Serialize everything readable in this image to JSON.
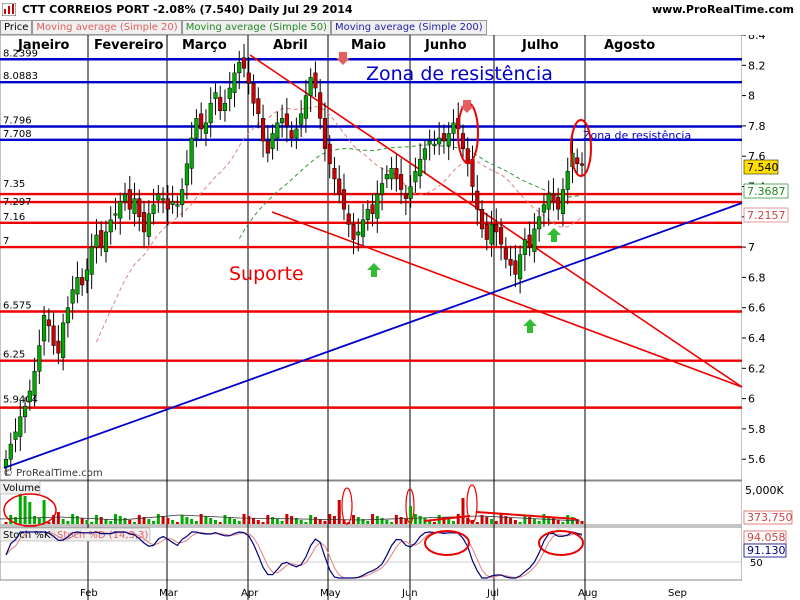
{
  "header": {
    "title": "CTT CORREIOS PORT   -2.08% (7.540)   Daily   Jul 29 2014",
    "site": "www.ProRealTime.com",
    "legend": {
      "price": "Price",
      "ma20": "Moving average (Simple 20)",
      "ma50": "Moving average (Simple 50)",
      "ma200": "Moving average (Simple 200)"
    },
    "copyright": "© ProRealTime.com"
  },
  "colors": {
    "up": "#00aa00",
    "down": "#cc0000",
    "resistance": "#0000cc",
    "support": "#ee0000",
    "ma20": "#e08080",
    "ma50": "#339933",
    "stoch_k": "#000080",
    "stoch_d": "#e08080"
  },
  "annotations": {
    "zona_main": "Zona de resistência",
    "zona_small": "Zona de resistência",
    "suporte": "Suporte"
  },
  "months": [
    "Janeiro",
    "Fevereiro",
    "Março",
    "Abril",
    "Maio",
    "Junho",
    "Julho",
    "Agosto"
  ],
  "price_tags": {
    "last": "7.540",
    "ma50": "7.3687",
    "ma20": "7.2157"
  },
  "volume_panel": {
    "label": "Volume",
    "max": "5,000K",
    "last": "373,750"
  },
  "stoch_panel": {
    "label_k": "Stoch %K",
    "label_d": "Stoch %D (14,3,3)",
    "d_value": "94.058",
    "k_value": "91.130",
    "level": "50"
  },
  "chart_data": {
    "type": "candlestick",
    "y_axis_ticks": [
      "8.4",
      "8.2",
      "8",
      "7.8",
      "7.6",
      "7.4",
      "7.2",
      "7",
      "6.8",
      "6.6",
      "6.4",
      "6.2",
      "6",
      "5.8",
      "5.6"
    ],
    "x_axis_labels": [
      "Feb",
      "Mar",
      "Apr",
      "May",
      "Jun",
      "Jul",
      "Aug",
      "Sep"
    ],
    "ylim": [
      5.5,
      8.45
    ],
    "horizontal_levels": [
      {
        "label": "8.2399",
        "value": 8.2399,
        "color": "blue"
      },
      {
        "label": "8.0883",
        "value": 8.0883,
        "color": "blue"
      },
      {
        "label": "7.796",
        "value": 7.796,
        "color": "blue"
      },
      {
        "label": "7.708",
        "value": 7.708,
        "color": "blue"
      },
      {
        "label": "7.35",
        "value": 7.35,
        "color": "red"
      },
      {
        "label": "7.297",
        "value": 7.297,
        "color": "red"
      },
      {
        "label": "7.16",
        "value": 7.16,
        "color": "red"
      },
      {
        "label": "7",
        "value": 7.0,
        "color": "red"
      },
      {
        "label": "6.575",
        "value": 6.575,
        "color": "red"
      },
      {
        "label": "6.25",
        "value": 6.25,
        "color": "red"
      },
      {
        "label": "5.9404",
        "value": 5.9404,
        "color": "red"
      }
    ],
    "close_series": [
      5.6,
      5.7,
      5.78,
      5.88,
      5.95,
      6.05,
      6.18,
      6.35,
      6.55,
      6.48,
      6.35,
      6.3,
      6.5,
      6.6,
      6.72,
      6.8,
      6.75,
      6.85,
      7.0,
      7.08,
      7.0,
      7.1,
      7.18,
      7.22,
      7.3,
      7.35,
      7.25,
      7.32,
      7.2,
      7.1,
      7.22,
      7.28,
      7.35,
      7.32,
      7.25,
      7.3,
      7.28,
      7.38,
      7.55,
      7.72,
      7.85,
      7.78,
      7.82,
      7.95,
      8.02,
      7.9,
      7.95,
      8.05,
      8.15,
      8.22,
      8.18,
      8.08,
      7.95,
      7.88,
      7.7,
      7.62,
      7.75,
      7.82,
      7.85,
      7.8,
      7.72,
      7.78,
      7.88,
      8.0,
      8.12,
      8.05,
      7.85,
      7.65,
      7.55,
      7.45,
      7.35,
      7.25,
      7.15,
      7.05,
      7.1,
      7.18,
      7.25,
      7.22,
      7.35,
      7.42,
      7.48,
      7.52,
      7.45,
      7.38,
      7.32,
      7.4,
      7.5,
      7.58,
      7.65,
      7.7,
      7.68,
      7.72,
      7.7,
      7.75,
      7.82,
      7.78,
      7.65,
      7.55,
      7.4,
      7.25,
      7.12,
      7.05,
      7.15,
      7.1,
      7.02,
      6.92,
      6.88,
      6.82,
      6.95,
      7.05,
      7.0,
      7.12,
      7.2,
      7.28,
      7.35,
      7.3,
      7.25,
      7.38,
      7.5,
      7.62,
      7.55,
      7.54
    ]
  }
}
